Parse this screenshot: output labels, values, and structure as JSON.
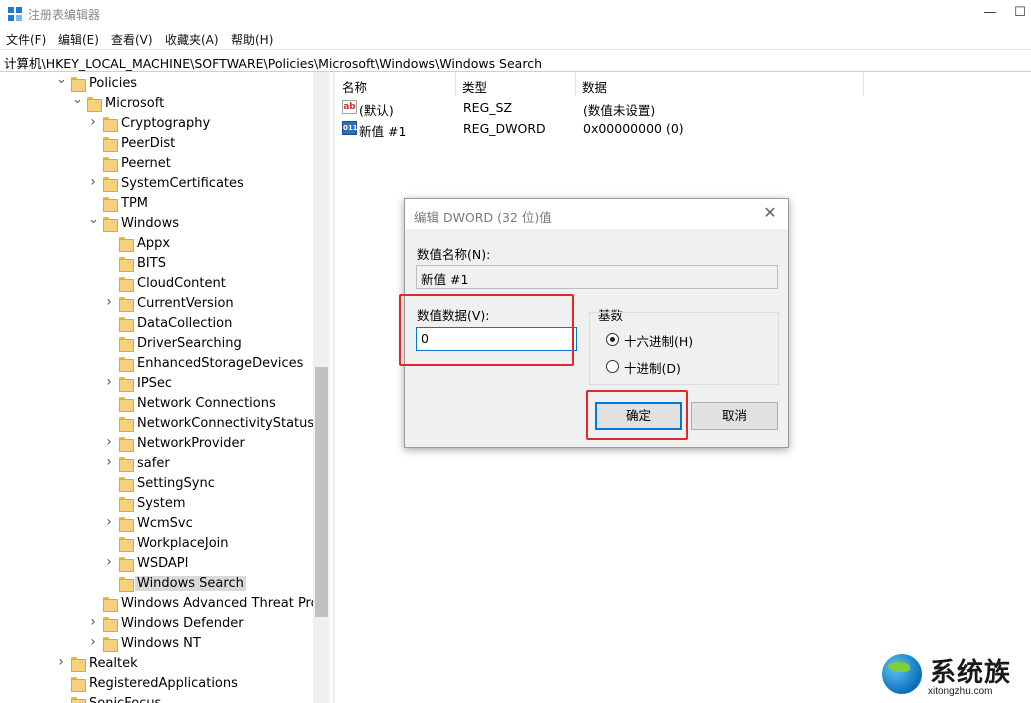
{
  "window": {
    "title": "注册表编辑器",
    "minimize": "—",
    "maximize": "☐"
  },
  "menu": [
    "文件(F)",
    "编辑(E)",
    "查看(V)",
    "收藏夹(A)",
    "帮助(H)"
  ],
  "address": "计算机\\HKEY_LOCAL_MACHINE\\SOFTWARE\\Policies\\Microsoft\\Windows\\Windows Search",
  "tree": [
    {
      "label": "Policies"
    },
    {
      "label": "Microsoft"
    },
    {
      "label": "Cryptography"
    },
    {
      "label": "PeerDist"
    },
    {
      "label": "Peernet"
    },
    {
      "label": "SystemCertificates"
    },
    {
      "label": "TPM"
    },
    {
      "label": "Windows"
    },
    {
      "label": "Appx"
    },
    {
      "label": "BITS"
    },
    {
      "label": "CloudContent"
    },
    {
      "label": "CurrentVersion"
    },
    {
      "label": "DataCollection"
    },
    {
      "label": "DriverSearching"
    },
    {
      "label": "EnhancedStorageDevices"
    },
    {
      "label": "IPSec"
    },
    {
      "label": "Network Connections"
    },
    {
      "label": "NetworkConnectivityStatusIndi"
    },
    {
      "label": "NetworkProvider"
    },
    {
      "label": "safer"
    },
    {
      "label": "SettingSync"
    },
    {
      "label": "System"
    },
    {
      "label": "WcmSvc"
    },
    {
      "label": "WorkplaceJoin"
    },
    {
      "label": "WSDAPI"
    },
    {
      "label": "Windows Search"
    },
    {
      "label": "Windows Advanced Threat Prote"
    },
    {
      "label": "Windows Defender"
    },
    {
      "label": "Windows NT"
    },
    {
      "label": "Realtek"
    },
    {
      "label": "RegisteredApplications"
    },
    {
      "label": "SonicFocus"
    }
  ],
  "columns": {
    "name": "名称",
    "type": "类型",
    "data": "数据"
  },
  "values": [
    {
      "icon": "ab",
      "name": "(默认)",
      "type": "REG_SZ",
      "data": "(数值未设置)"
    },
    {
      "icon": "011",
      "name": "新值 #1",
      "type": "REG_DWORD",
      "data": "0x00000000 (0)"
    }
  ],
  "dialog": {
    "title": "编辑 DWORD (32 位)值",
    "close": "✕",
    "name_label": "数值名称(N):",
    "name_value": "新值 #1",
    "data_label": "数值数据(V):",
    "data_value": "0",
    "base_label": "基数",
    "hex_label": "十六进制(H)",
    "dec_label": "十进制(D)",
    "base_selected": "hex",
    "ok": "确定",
    "cancel": "取消"
  },
  "watermark": {
    "cn": "系统族",
    "en": "xitongzhu.com"
  },
  "colors": {
    "highlight": "#e02a2a",
    "accent": "#0078d7",
    "folder": "#f5d27a"
  }
}
